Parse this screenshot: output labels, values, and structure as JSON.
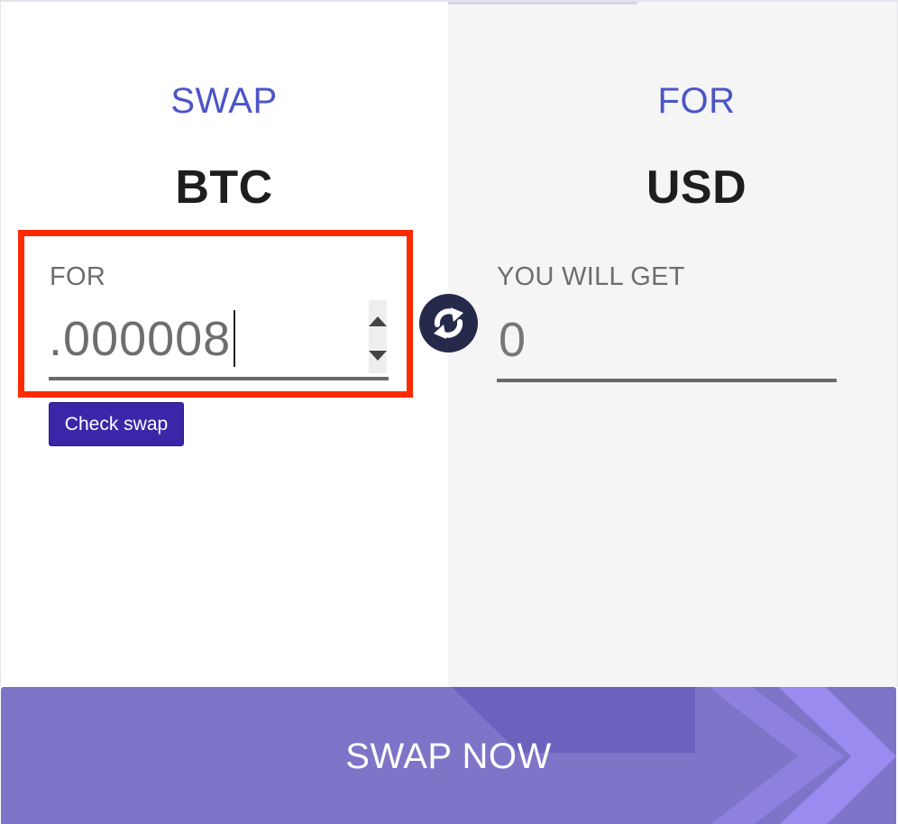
{
  "swap": {
    "heading": "SWAP",
    "currency": "BTC",
    "amount_label": "FOR",
    "amount_value": ".000008",
    "check_button_label": "Check swap"
  },
  "for": {
    "heading": "FOR",
    "currency": "USD",
    "result_label": "YOU WILL GET",
    "result_value": "0"
  },
  "exchange_icon": "refresh-arrows-icon",
  "swap_now_label": "SWAP NOW",
  "colors": {
    "heading_blue": "#4b55c8",
    "highlight_red": "#ff2a00",
    "check_button": "#3a27a8",
    "swap_now_bg": "#7e74c8",
    "icon_dark": "#262a4a"
  }
}
